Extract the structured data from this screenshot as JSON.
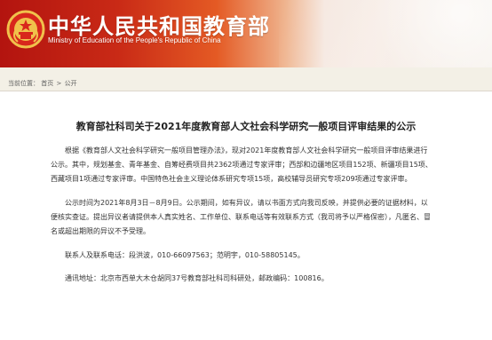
{
  "header": {
    "title_zh": "中华人民共和国教育部",
    "title_en": "Ministry of Education of the People's Republic of China",
    "emblem_icon": "national-emblem-icon",
    "colors": {
      "red": "#c3271b",
      "gold": "#f0c14b"
    }
  },
  "breadcrumb": {
    "prefix": "当前位置：",
    "items": [
      "首页",
      "公开"
    ],
    "separator": ">"
  },
  "article": {
    "title": "教育部社科司关于2021年度教育部人文社会科学研究一般项目评审结果的公示",
    "paragraphs": [
      "根据《教育部人文社会科学研究一般项目管理办法》，现对2021年度教育部人文社会科学研究一般项目评审结果进行公示。其中，规划基金、青年基金、自筹经费项目共2362项通过专家评审；西部和边疆地区项目152项、新疆项目15项、西藏项目1项通过专家评审。中国特色社会主义理论体系研究专项15项，高校辅导员研究专项209项通过专家评审。",
      "公示时间为2021年8月3日－8月9日。公示期间，如有异议，请以书面方式向我司反映，并提供必要的证据材料，以便核实查证。提出异议者请提供本人真实姓名、工作单位、联系电话等有效联系方式（我司将予以严格保密），凡匿名、冒名或超出期限的异议不予受理。",
      "联系人及联系电话：段洪波，010-66097563；范明宇，010-58805145。",
      "通讯地址：北京市西单大木仓胡同37号教育部社科司科研处，邮政编码：100816。"
    ]
  }
}
